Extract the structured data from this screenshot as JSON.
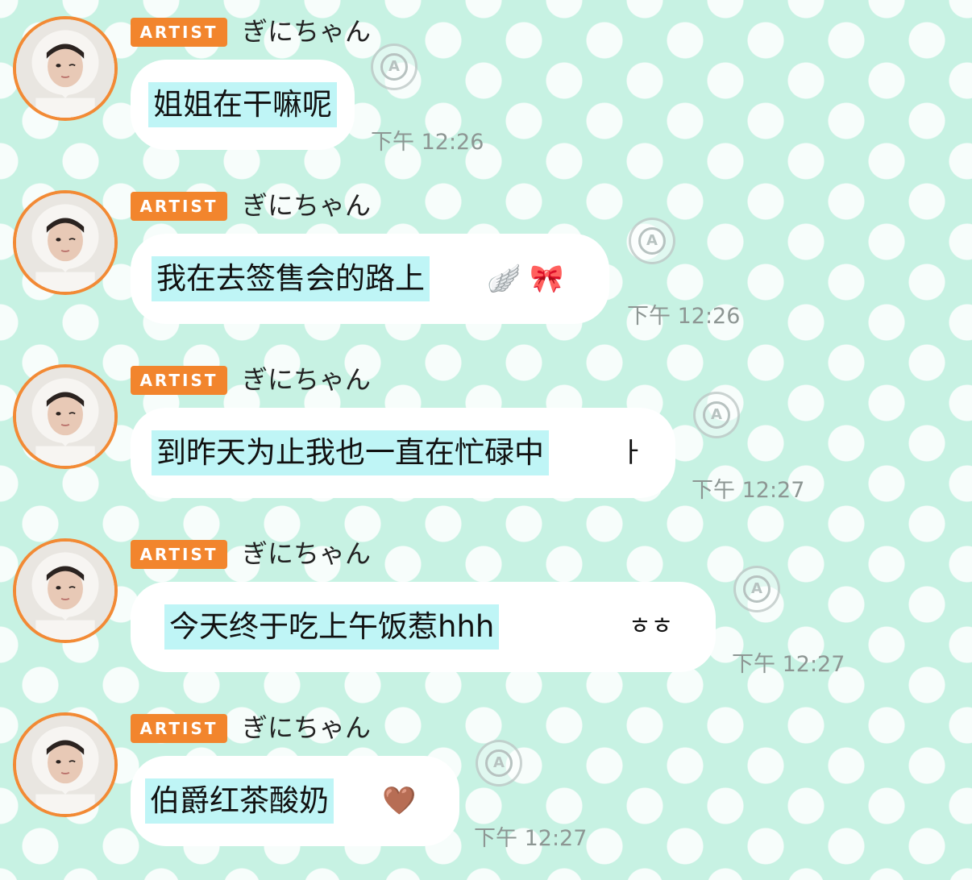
{
  "messages": [
    {
      "badge": "ARTIST",
      "sender": "ぎにちゃん",
      "text": "姐姐在干嘛呢",
      "extra": "",
      "time": "下午 12:26",
      "translate_icon": "translate-a-icon"
    },
    {
      "badge": "ARTIST",
      "sender": "ぎにちゃん",
      "text": "我在去签售会的路上",
      "extra": "🪽 🎀",
      "time": "下午 12:26",
      "translate_icon": "translate-a-icon"
    },
    {
      "badge": "ARTIST",
      "sender": "ぎにちゃん",
      "text": "到昨天为止我也一直在忙碌中",
      "extra": "ㅏ",
      "time": "下午 12:27",
      "translate_icon": "translate-a-icon"
    },
    {
      "badge": "ARTIST",
      "sender": "ぎにちゃん",
      "text": "今天终于吃上午饭惹hhh",
      "extra": "ㅎㅎ",
      "time": "下午 12:27",
      "translate_icon": "translate-a-icon"
    },
    {
      "badge": "ARTIST",
      "sender": "ぎにちゃん",
      "text": "伯爵红茶酸奶",
      "extra": "🤎",
      "time": "下午 12:27",
      "translate_icon": "translate-a-icon"
    }
  ],
  "colors": {
    "background": "#c7f2e3",
    "badge": "#f2852d",
    "avatar_ring": "#f28a35",
    "text_highlight": "#bff5f6",
    "timestamp": "#8d9693"
  }
}
